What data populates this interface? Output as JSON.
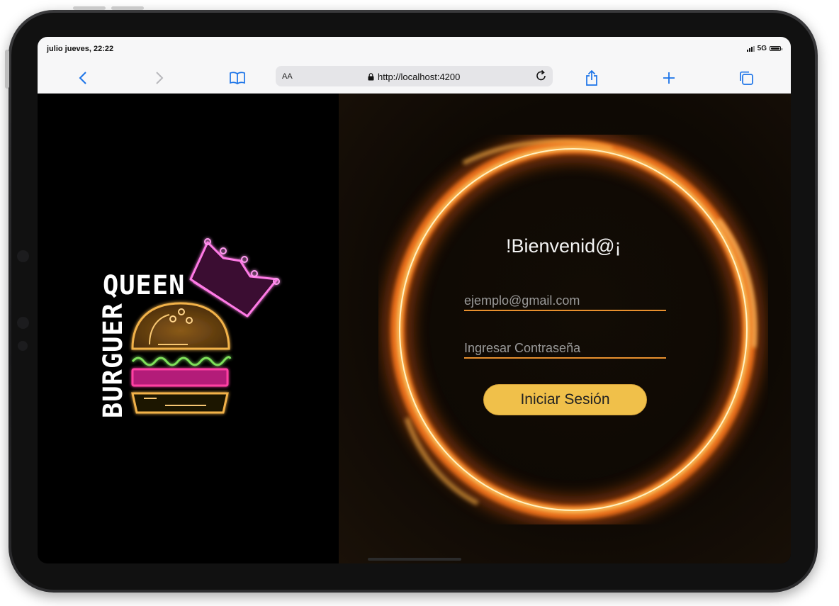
{
  "status_bar": {
    "time": "julio jueves, 22:22",
    "network": "5G"
  },
  "browser": {
    "reader_label": "AA",
    "url": "http://localhost:4200",
    "icons": [
      "back-icon",
      "forward-icon",
      "bookmarks-icon",
      "lock-icon",
      "reload-icon",
      "share-icon",
      "new-tab-icon",
      "tabs-icon"
    ]
  },
  "logo": {
    "word1": "BURGUER",
    "word2": "QUEEN",
    "colors": {
      "crown": "#ff7ae6",
      "bun": "#f2b24a",
      "lettuce": "#7ee05a",
      "patty": "#ff3fa4",
      "text": "#ffffff"
    }
  },
  "login": {
    "title": "!Bienvenid@¡",
    "email_placeholder": "ejemplo@gmail.com",
    "password_placeholder": "Ingresar Contraseña",
    "submit_label": "Iniciar Sesión",
    "accent": "#e8902e",
    "button_color": "#f0c04a"
  }
}
